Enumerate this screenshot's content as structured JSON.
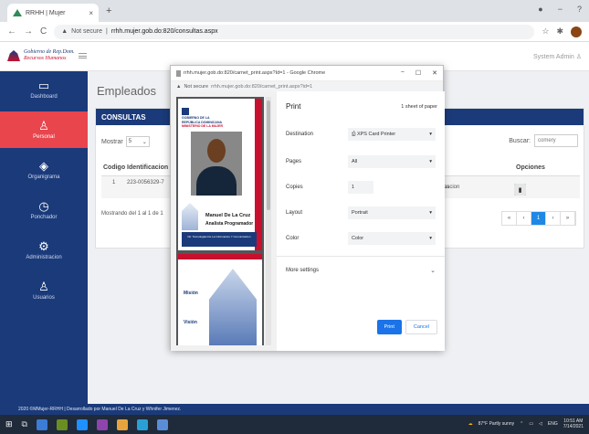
{
  "browser": {
    "tab_title": "RRHH | Mujer",
    "tab_close": "×",
    "new_tab": "+",
    "not_secure": "Not secure",
    "url": "rrhh.mujer.gob.do:820/consultas.aspx"
  },
  "app": {
    "logo_line1": "Gobierno de Rep.Dom.",
    "logo_line2": "Recursos Humanos",
    "user": "System Admin"
  },
  "sidebar": {
    "items": [
      {
        "label": "Dashboard",
        "icon": "monitor-icon",
        "glyph": "▭"
      },
      {
        "label": "Personal",
        "icon": "person-icon",
        "glyph": "♙"
      },
      {
        "label": "Organigrama",
        "icon": "layers-icon",
        "glyph": "◈"
      },
      {
        "label": "Ponchador",
        "icon": "clock-icon",
        "glyph": "◷"
      },
      {
        "label": "Administracion",
        "icon": "gear-icon",
        "glyph": "⚙"
      },
      {
        "label": "Usuarios",
        "icon": "user-icon",
        "glyph": "♙"
      }
    ]
  },
  "main": {
    "page_title": "Empleados",
    "panel_title": "CONSULTAS",
    "show_label": "Mostrar",
    "show_value": "5",
    "search_label": "Buscar:",
    "search_value": "comery",
    "columns": [
      "Codigo",
      "Identificacion",
      "Opciones"
    ],
    "row": {
      "code": "1",
      "id": "223-0056329-7",
      "dept_line1": "ologias de la",
      "dept_line2": "municacion"
    },
    "showing": "Mostrando del 1 al 1 de 1",
    "pager": [
      "«",
      "‹",
      "1",
      "›",
      "»"
    ]
  },
  "footer": "2020 ©MMujer-RRHH | Desarrollado por Manuel De La Cruz y Whnifer Jimenez.",
  "popup": {
    "title": "rrhh.mujer.gob.do:820/carnet_print.aspx?Id=1 - Google Chrome",
    "not_secure": "Not secure",
    "url": "rrhh.mujer.gob.do:820/carnet_print.aspx?id=1",
    "card": {
      "gov_line1": "GOBIERNO DE LA",
      "gov_line2": "REPÚBLICA DOMINICANA",
      "ministry": "MINISTERIO DE LA MUJER",
      "name": "Manuel De La Cruz",
      "position": "Analista Programador",
      "dept": "Dir. Tecnologias De La Informacion Y Comunicacion",
      "mision": "Misión",
      "vision": "Visión"
    },
    "print": {
      "title": "Print",
      "sheets": "1 sheet of paper",
      "destination_label": "Destination",
      "destination_value": "XPS Card Printer",
      "pages_label": "Pages",
      "pages_value": "All",
      "copies_label": "Copies",
      "copies_value": "1",
      "layout_label": "Layout",
      "layout_value": "Portrait",
      "color_label": "Color",
      "color_value": "Color",
      "more_settings": "More settings",
      "print_button": "Print",
      "cancel_button": "Cancel"
    }
  },
  "taskbar": {
    "weather": "87°F Partly sunny",
    "lang": "ENG",
    "time": "10:51 AM",
    "date": "7/14/2021"
  },
  "colors": {
    "primary": "#1a3a7a",
    "accent": "#e8454d",
    "print_blue": "#1a73e8"
  }
}
